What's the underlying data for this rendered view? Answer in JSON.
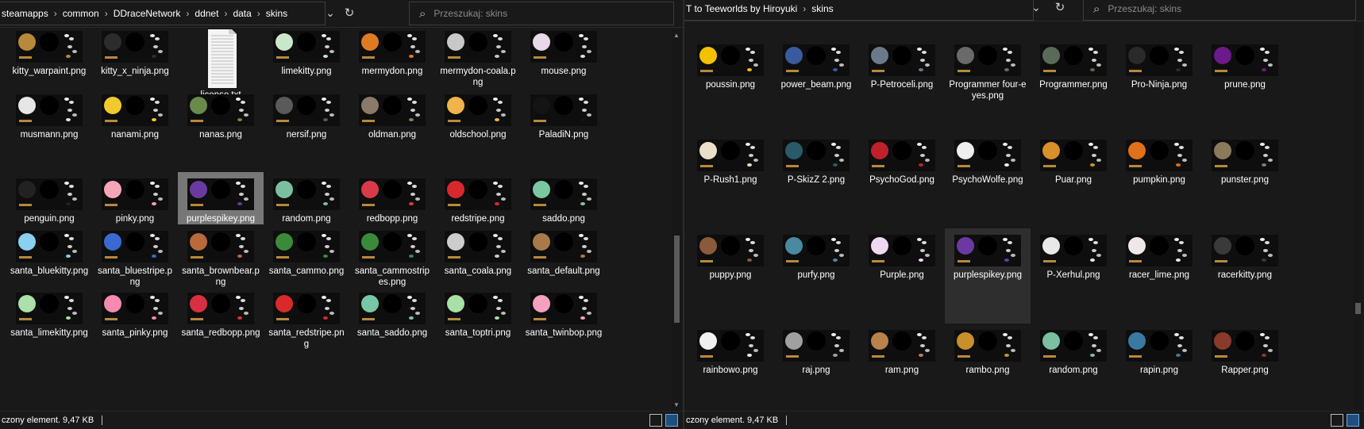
{
  "left": {
    "breadcrumb": [
      "steamapps",
      "common",
      "DDraceNetwork",
      "ddnet",
      "data",
      "skins"
    ],
    "search_placeholder": "Przeszukaj: skins",
    "status_text": "czony element. 9,47 KB",
    "files": [
      "kitty_warpaint.png",
      "kitty_x_ninja.png",
      "license.txt",
      "limekitty.png",
      "mermydon.png",
      "mermydon-coala.png",
      "mouse.png",
      "musmann.png",
      "nanami.png",
      "nanas.png",
      "nersif.png",
      "oldman.png",
      "oldschool.png",
      "PaladiN.png",
      "penguin.png",
      "pinky.png",
      "purplespikey.png",
      "random.png",
      "redbopp.png",
      "redstripe.png",
      "saddo.png",
      "santa_bluekitty.png",
      "santa_bluestripe.png",
      "santa_brownbear.png",
      "santa_cammo.png",
      "santa_cammostripes.png",
      "santa_coala.png",
      "santa_default.png",
      "santa_limekitty.png",
      "santa_pinky.png",
      "santa_redbopp.png",
      "santa_redstripe.png",
      "santa_saddo.png",
      "santa_toptri.png",
      "santa_twinbop.png"
    ],
    "selected": "purplespikey.png"
  },
  "right": {
    "breadcrumb": [
      "T to Teeworlds by Hiroyuki",
      "skins"
    ],
    "search_placeholder": "Przeszukaj: skins",
    "status_text": "czony element. 9,47 KB",
    "files": [
      "poussin.png",
      "power_beam.png",
      "P-Petroceli.png",
      "Programmer four-eyes.png",
      "Programmer.png",
      "Pro-Ninja.png",
      "prune.png",
      "P-Rush1.png",
      "P-SkizZ 2.png",
      "PsychoGod.png",
      "PsychoWolfe.png",
      "Puar.png",
      "pumpkin.png",
      "punster.png",
      "puppy.png",
      "purfy.png",
      "Purple.png",
      "purplespikey.png",
      "P-Xerhul.png",
      "racer_lime.png",
      "racerkitty.png",
      "rainbowo.png",
      "raj.png",
      "ram.png",
      "rambo.png",
      "random.png",
      "rapin.png",
      "Rapper.png"
    ],
    "selected": "purplespikey.png"
  },
  "skin_colors": {
    "kitty_warpaint.png": "#b8893a",
    "kitty_x_ninja.png": "#2c2c2c",
    "limekitty.png": "#c9e7c9",
    "mermydon.png": "#e07a22",
    "mermydon-coala.png": "#c8c8c8",
    "mouse.png": "#e8d8e8",
    "musmann.png": "#e6e6e6",
    "nanami.png": "#f2c92c",
    "nanas.png": "#6a8a4a",
    "nersif.png": "#5a5a5a",
    "oldman.png": "#8a7a6a",
    "oldschool.png": "#f1b44a",
    "PaladiN.png": "#141414",
    "penguin.png": "#222222",
    "pinky.png": "#f4a6b8",
    "purplespikey.png": "#6a3aa2",
    "random.png": "#7ac0a0",
    "redbopp.png": "#d83a4a",
    "redstripe.png": "#d8282e",
    "saddo.png": "#7ac8a0",
    "santa_bluekitty.png": "#8ad0f0",
    "santa_bluestripe.png": "#3a6ad0",
    "santa_brownbear.png": "#b86a3a",
    "santa_cammo.png": "#3a8a3a",
    "santa_cammostripes.png": "#3a8a3a",
    "santa_coala.png": "#cccccc",
    "santa_default.png": "#a87a4a",
    "santa_limekitty.png": "#aae0aa",
    "santa_pinky.png": "#f48ab0",
    "santa_redbopp.png": "#d83040",
    "santa_redstripe.png": "#d82a2a",
    "santa_saddo.png": "#78c8a8",
    "santa_toptri.png": "#a8e0a8",
    "santa_twinbop.png": "#f4a0c0",
    "poussin.png": "#f2c200",
    "power_beam.png": "#3a5aa0",
    "P-Petroceli.png": "#6a7a8a",
    "Programmer four-eyes.png": "#6a6a6a",
    "Programmer.png": "#5a6a5a",
    "Pro-Ninja.png": "#2a2a2a",
    "prune.png": "#6a1a8a",
    "P-Rush1.png": "#e8e0c8",
    "P-SkizZ 2.png": "#2a5a6a",
    "PsychoGod.png": "#c0202a",
    "PsychoWolfe.png": "#eeeeee",
    "Puar.png": "#d8902a",
    "pumpkin.png": "#e0701a",
    "punster.png": "#8a7a5a",
    "puppy.png": "#8a5a3a",
    "purfy.png": "#4a8aa0",
    "Purple.png": "#f0d8f0",
    "P-Xerhul.png": "#e8e8e8",
    "racer_lime.png": "#f0e8e8",
    "racerkitty.png": "#3a3a3a",
    "rainbowo.png": "#f0f0f0",
    "raj.png": "#a0a0a0",
    "ram.png": "#b8824a",
    "rambo.png": "#c8902a",
    "rapin.png": "#3a7aa0",
    "Rapper.png": "#8a3a2a"
  },
  "icons": {
    "breadcrumb_separator": "›",
    "dropdown": "⌄",
    "refresh": "↻",
    "search": "⌕"
  }
}
